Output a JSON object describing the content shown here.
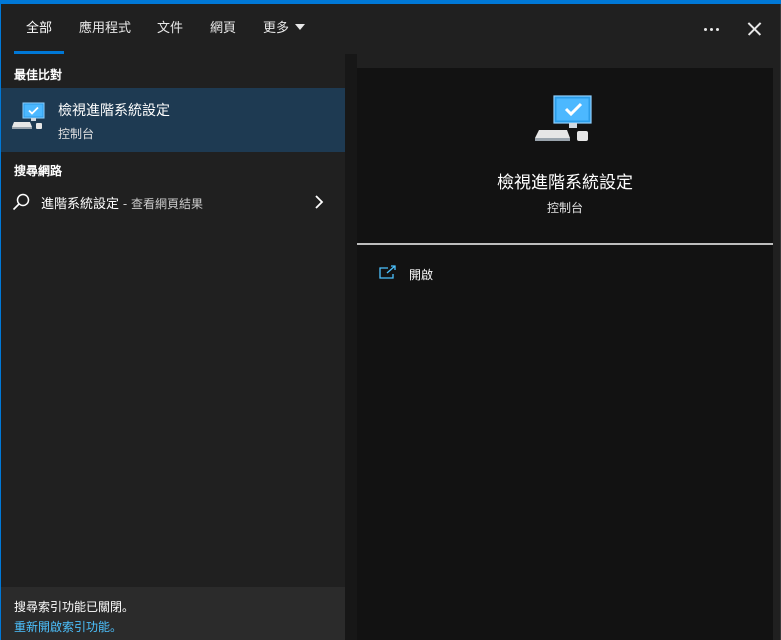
{
  "header": {
    "tabs": [
      {
        "label": "全部",
        "active": true
      },
      {
        "label": "應用程式"
      },
      {
        "label": "文件"
      },
      {
        "label": "網頁"
      },
      {
        "label": "更多"
      }
    ]
  },
  "best_match": {
    "heading": "最佳比對",
    "title": "檢視進階系統設定",
    "subtitle": "控制台",
    "icon": "computer-check-icon"
  },
  "web_search": {
    "heading": "搜尋網路",
    "query": "進階系統設定",
    "suffix": " - 查看網頁結果"
  },
  "footer": {
    "message": "搜尋索引功能已關閉。",
    "link": "重新開啟索引功能。"
  },
  "detail": {
    "title": "檢視進階系統設定",
    "subtitle": "控制台",
    "actions": [
      {
        "label": "開啟",
        "icon": "open-icon"
      }
    ]
  },
  "colors": {
    "accent": "#0078d7",
    "selection": "#1e3a52",
    "link": "#4cc2ff"
  }
}
